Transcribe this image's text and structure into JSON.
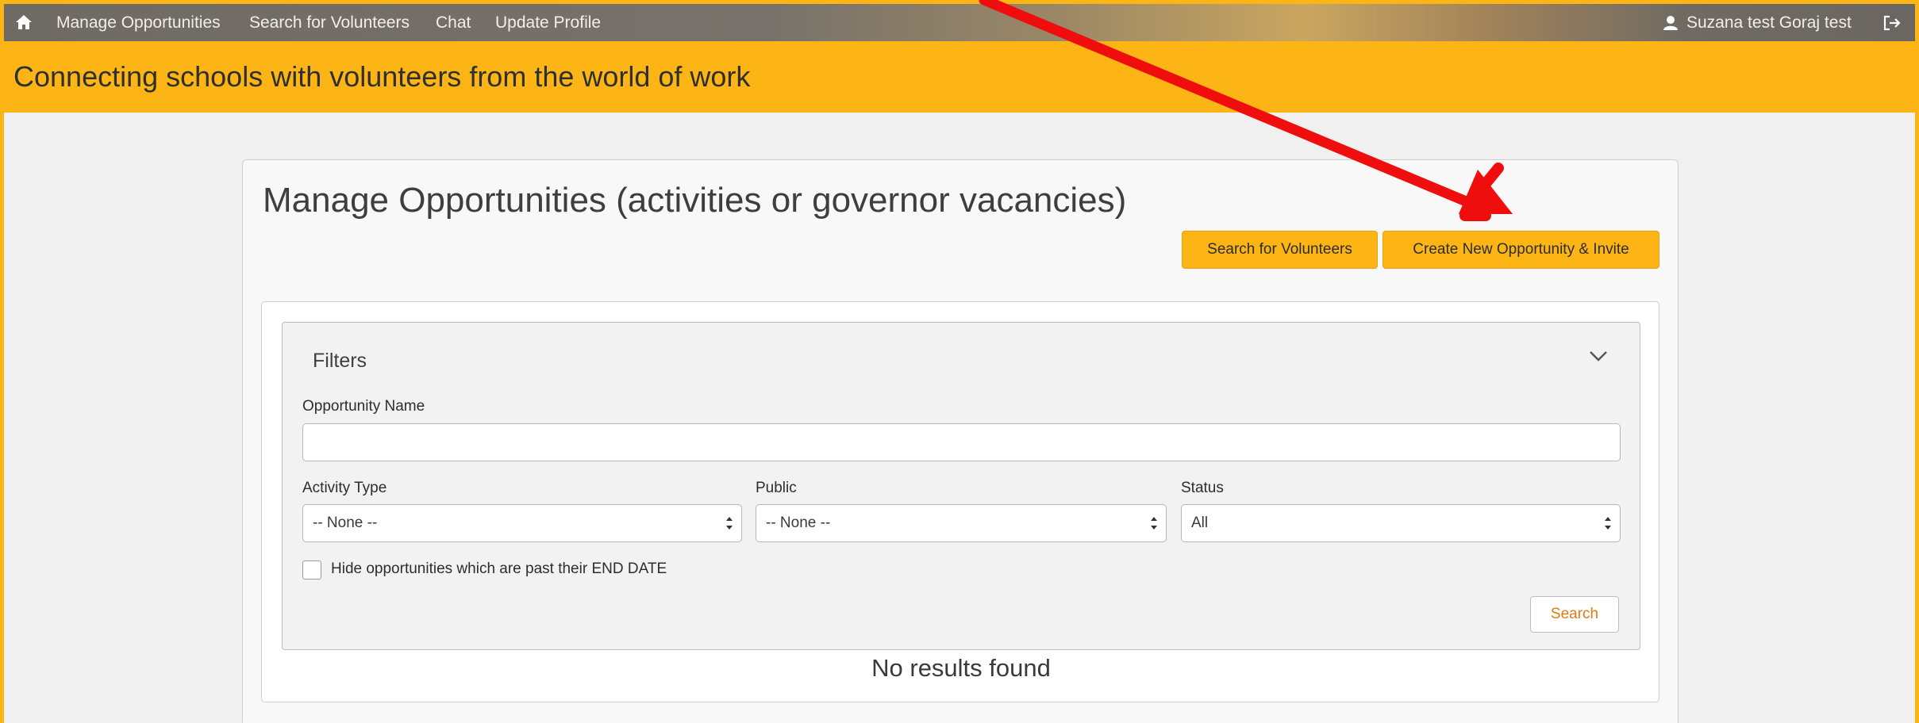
{
  "nav": {
    "items": [
      {
        "label": "Manage Opportunities"
      },
      {
        "label": "Search for Volunteers"
      },
      {
        "label": "Chat"
      },
      {
        "label": "Update Profile"
      }
    ],
    "user_name": "Suzana test Goraj test",
    "icons": {
      "home": "home-icon",
      "user": "user-icon",
      "logout": "logout-icon"
    }
  },
  "banner": {
    "title": "Connecting schools with volunteers from the world of work"
  },
  "main": {
    "title": "Manage Opportunities (activities or governor vacancies)",
    "buttons": {
      "search_volunteers": "Search for Volunteers",
      "create_opportunity": "Create New Opportunity & Invite"
    }
  },
  "filters": {
    "title": "Filters",
    "opportunity_name": {
      "label": "Opportunity Name",
      "value": ""
    },
    "activity_type": {
      "label": "Activity Type",
      "value": "-- None --"
    },
    "public": {
      "label": "Public",
      "value": "-- None --"
    },
    "status": {
      "label": "Status",
      "value": "All"
    },
    "hide_past": {
      "label": "Hide opportunities which are past their END DATE",
      "checked": false
    },
    "search_button": "Search"
  },
  "results": {
    "empty_message": "No results found"
  },
  "colors": {
    "accent": "#fcb514",
    "nav_text": "#f3efe8",
    "search_link": "#e07b14",
    "annotation_arrow": "#f00d0d"
  }
}
